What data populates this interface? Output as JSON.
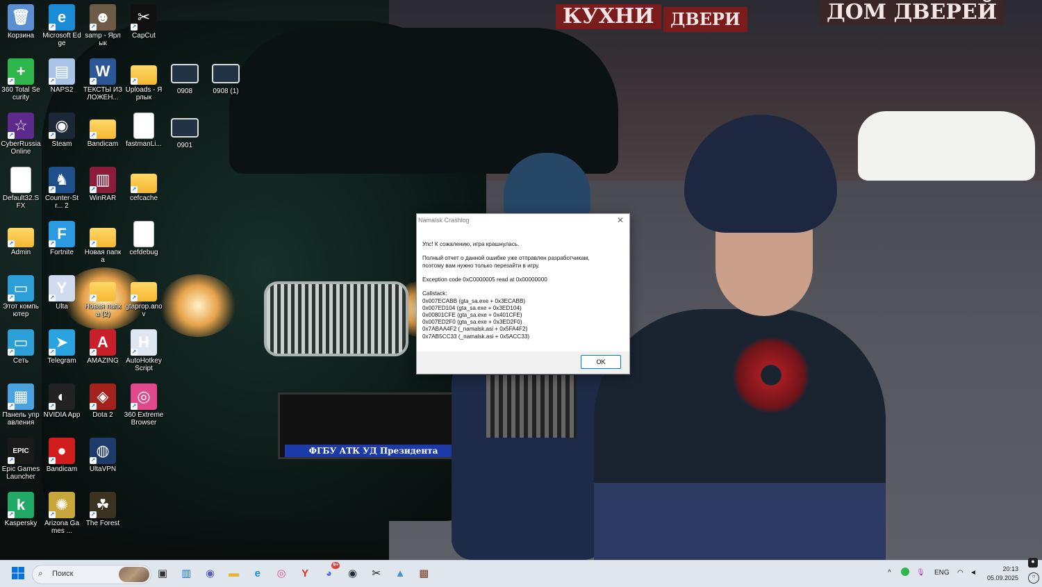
{
  "desktop": {
    "icons": [
      {
        "label": "Корзина",
        "glyph": "🗑",
        "color": "#5b8fd1"
      },
      {
        "label": "Microsoft Edge",
        "glyph": "e",
        "color": "#1b8bd6"
      },
      {
        "label": "samp - Ярлык",
        "glyph": "☻",
        "color": "#6d5b48"
      },
      {
        "label": "CapCut",
        "glyph": "✂",
        "color": "#111111"
      },
      {
        "label": "360 Total Security",
        "glyph": "+",
        "color": "#2fb64a"
      },
      {
        "label": "NAPS2",
        "glyph": "▤",
        "color": "#a9c4e6"
      },
      {
        "label": "ТЕКСТЫ ИЗЛОЖЕН...",
        "glyph": "W",
        "color": "#2b5797"
      },
      {
        "label": "Uploads - Ярлык",
        "glyph": "",
        "color": "folder"
      },
      {
        "label": "0908",
        "glyph": "",
        "color": "thumb"
      },
      {
        "label": "0908 (1)",
        "glyph": "",
        "color": "thumb"
      },
      {
        "label": "CyberRussia Online",
        "glyph": "☆",
        "color": "#5b2a8a"
      },
      {
        "label": "Steam",
        "glyph": "◉",
        "color": "#1b2838"
      },
      {
        "label": "Bandicam",
        "glyph": "",
        "color": "folder"
      },
      {
        "label": "fastmanLi...",
        "glyph": "",
        "color": "file"
      },
      {
        "label": "0901",
        "glyph": "",
        "color": "thumb"
      },
      {
        "label": "Default32.SFX",
        "glyph": "",
        "color": "file"
      },
      {
        "label": "Counter-Str... 2",
        "glyph": "♞",
        "color": "#1f4f8a"
      },
      {
        "label": "WinRAR",
        "glyph": "▥",
        "color": "#8b1c3a"
      },
      {
        "label": "cefcache",
        "glyph": "",
        "color": "folder"
      },
      {
        "label": "Admin",
        "glyph": "",
        "color": "folder"
      },
      {
        "label": "Fortnite",
        "glyph": "F",
        "color": "#2a9be0"
      },
      {
        "label": "Новая папка",
        "glyph": "",
        "color": "folder"
      },
      {
        "label": "cefdebug",
        "glyph": "",
        "color": "file"
      },
      {
        "label": "Этот компьютер",
        "glyph": "▭",
        "color": "#2d9fd8"
      },
      {
        "label": "Ulta",
        "glyph": "Y",
        "color": "#cfdcef"
      },
      {
        "label": "Новая папка (2)",
        "glyph": "",
        "color": "folder"
      },
      {
        "label": "gtaprop.anov",
        "glyph": "",
        "color": "folder"
      },
      {
        "label": "Сеть",
        "glyph": "▭",
        "color": "#2d9fd8"
      },
      {
        "label": "Telegram",
        "glyph": "➤",
        "color": "#2aa3e0"
      },
      {
        "label": "AMAZING",
        "glyph": "A",
        "color": "#c81f2b"
      },
      {
        "label": "AutoHotkey Script",
        "glyph": "H",
        "color": "#dfe7f3"
      },
      {
        "label": "Панель управления",
        "glyph": "▦",
        "color": "#4aa3e0"
      },
      {
        "label": "NVIDIA App",
        "glyph": "◐",
        "color": "#222222"
      },
      {
        "label": "Dota 2",
        "glyph": "◈",
        "color": "#a3231c"
      },
      {
        "label": "360 Extreme Browser",
        "glyph": "◎",
        "color": "#e04a8a"
      },
      {
        "label": "Epic Games Launcher",
        "glyph": "EPIC",
        "color": "#1a1a1a"
      },
      {
        "label": "Bandicam",
        "glyph": "●",
        "color": "#d21d1d"
      },
      {
        "label": "UltaVPN",
        "glyph": "◍",
        "color": "#1d3b6b"
      },
      {
        "label": "Kaspersky",
        "glyph": "k",
        "color": "#1fa866"
      },
      {
        "label": "Arizona Games ...",
        "glyph": "✺",
        "color": "#c8a73a"
      },
      {
        "label": "The Forest",
        "glyph": "☘",
        "color": "#3b3320"
      }
    ]
  },
  "dialog": {
    "title": "Namalsk Crashlog",
    "lines": [
      "Упс! К сожалению, игра крашнулась.",
      "",
      "Полный отчет о данной ошибке уже отправлен разработчикам,",
      "поэтому вам нужно только перезайти в игру.",
      "",
      "Exception code 0xC0000005 read at 0x00000000",
      "",
      "Callstack:",
      "0x007ECABB (gta_sa.exe + 0x3ECABB)",
      "0x007ED104 (gta_sa.exe + 0x3ED104)",
      "0x00801CFE (gta_sa.exe + 0x401CFE)",
      "0x007ED2F0 (gta_sa.exe + 0x3ED2F0)",
      "0x7ABAA4F2 (_namalsk.asi + 0x5FA4F2)",
      "0x7AB5CC33 (_namalsk.asi + 0x5ACC33)"
    ],
    "ok_label": "OK"
  },
  "wallpaper": {
    "sign1": "КУХНИ",
    "sign2": "ДВЕРИ",
    "sign3": "ДОМ ДВЕРЕЙ",
    "plate": "ФГБУ АТК УД Президента"
  },
  "taskbar": {
    "search_placeholder": "Поиск",
    "apps": [
      {
        "name": "task-view",
        "glyph": "▣",
        "color": "#333333"
      },
      {
        "name": "widgets",
        "glyph": "▥",
        "color": "#1a73c8"
      },
      {
        "name": "chat",
        "glyph": "◉",
        "color": "#5b5fc7"
      },
      {
        "name": "explorer",
        "glyph": "▬",
        "color": "#e8b230"
      },
      {
        "name": "edge",
        "glyph": "e",
        "color": "#1b8bd6"
      },
      {
        "name": "360-browser",
        "glyph": "◎",
        "color": "#e04a8a"
      },
      {
        "name": "yandex",
        "glyph": "Y",
        "color": "#e02b2b"
      },
      {
        "name": "discord",
        "glyph": "◕",
        "color": "#5865f2"
      },
      {
        "name": "steam",
        "glyph": "◉",
        "color": "#1b2838"
      },
      {
        "name": "capcut",
        "glyph": "✂",
        "color": "#111111"
      },
      {
        "name": "photos",
        "glyph": "▲",
        "color": "#4a8fd8"
      },
      {
        "name": "game",
        "glyph": "▩",
        "color": "#7a3b22"
      }
    ],
    "badge": "9+",
    "language": "ENG",
    "time": "20:13",
    "date": "05.09.2025"
  }
}
